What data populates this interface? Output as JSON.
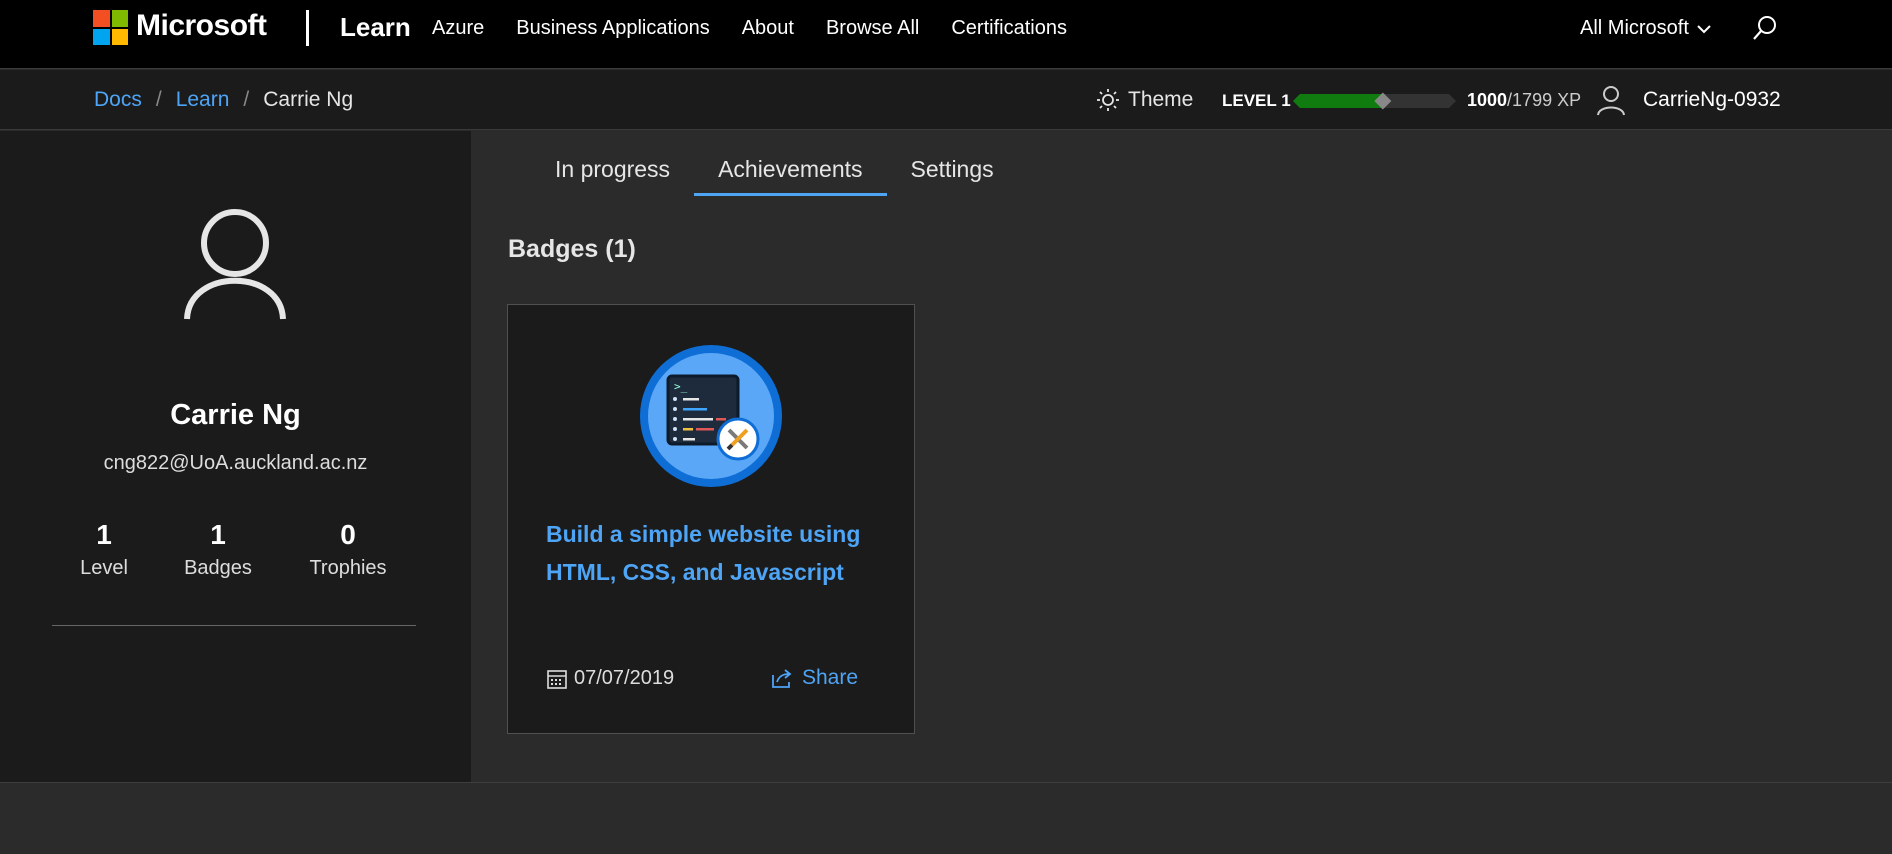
{
  "header": {
    "brand": "Microsoft",
    "product": "Learn",
    "nav_links": [
      "Azure",
      "Business Applications",
      "About",
      "Browse All",
      "Certifications"
    ],
    "all_microsoft": "All Microsoft",
    "logo_colors": [
      "#f25022",
      "#7fba00",
      "#00a4ef",
      "#ffb900"
    ]
  },
  "subbar": {
    "breadcrumbs": [
      "Docs",
      "Learn",
      "Carrie Ng"
    ],
    "separator": "/",
    "theme_label": "Theme",
    "level_label": "LEVEL 1",
    "xp_current": "1000",
    "xp_total": "/1799 XP",
    "xp_progress": 0.556,
    "username": "CarrieNg-0932"
  },
  "profile": {
    "name": "Carrie Ng",
    "email": "cng822@UoA.auckland.ac.nz",
    "stats": [
      {
        "value": "1",
        "label": "Level"
      },
      {
        "value": "1",
        "label": "Badges"
      },
      {
        "value": "0",
        "label": "Trophies"
      }
    ]
  },
  "main": {
    "tabs": [
      "In progress",
      "Achievements",
      "Settings"
    ],
    "active_tab": "Achievements",
    "badges_heading": "Badges (1)",
    "badge": {
      "title": "Build a simple website using HTML, CSS, and Javascript",
      "date": "07/07/2019",
      "share_label": "Share"
    }
  },
  "colors": {
    "accent": "#4ea4f5",
    "progress": "#107c10",
    "badge_blue": "#3f96f4"
  }
}
